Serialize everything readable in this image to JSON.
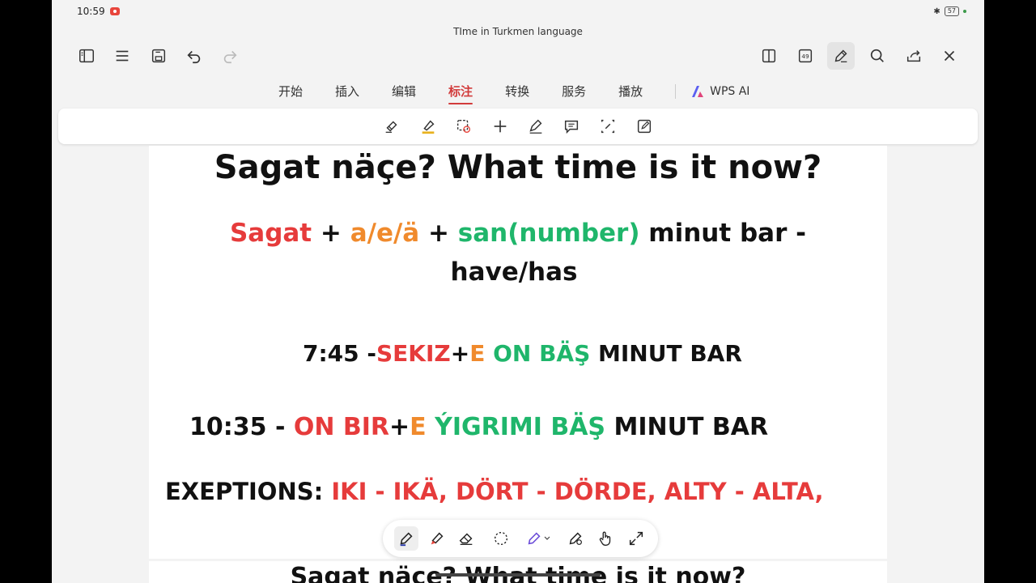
{
  "status_bar": {
    "time": "10:59",
    "battery": "57"
  },
  "document": {
    "title": "TIme in Turkmen language"
  },
  "ribbon_tabs": [
    "开始",
    "插入",
    "编辑",
    "标注",
    "转换",
    "服务",
    "播放"
  ],
  "ai_label": "WPS AI",
  "page_count_badge": "49",
  "accent_color": "#d23b3b",
  "slide": {
    "title": "Sagat näçe? What time is it now?",
    "formula": {
      "part1": "Sagat",
      "plus1": " + ",
      "part2": "a/e/ä",
      "plus2": " + ",
      "part3": "san(number)",
      "part4": " minut bar -",
      "line2": "have/has"
    },
    "example1": {
      "time": "7:45 -",
      "hour": "SEKIZ",
      "plus": "+",
      "suffix": "E",
      "minutes": " ON BÄŞ",
      "rest": " MINUT BAR"
    },
    "example2": {
      "time": "10:35 - ",
      "hour": "ON BIR",
      "plus": "+",
      "suffix": "E",
      "minutes": " ÝIGRIMI BÄŞ",
      "rest": " MINUT BAR"
    },
    "exceptions": {
      "label": "EXEPTIONS: ",
      "text": "IKI - IKÄ, DÖRT - DÖRDE, ALTY - ALTA,"
    },
    "next_slide_title": "Sagat näçe? What time is it now?"
  },
  "colors": {
    "red": "#e63b3b",
    "orange": "#f08a2c",
    "green": "#1fb66b"
  }
}
